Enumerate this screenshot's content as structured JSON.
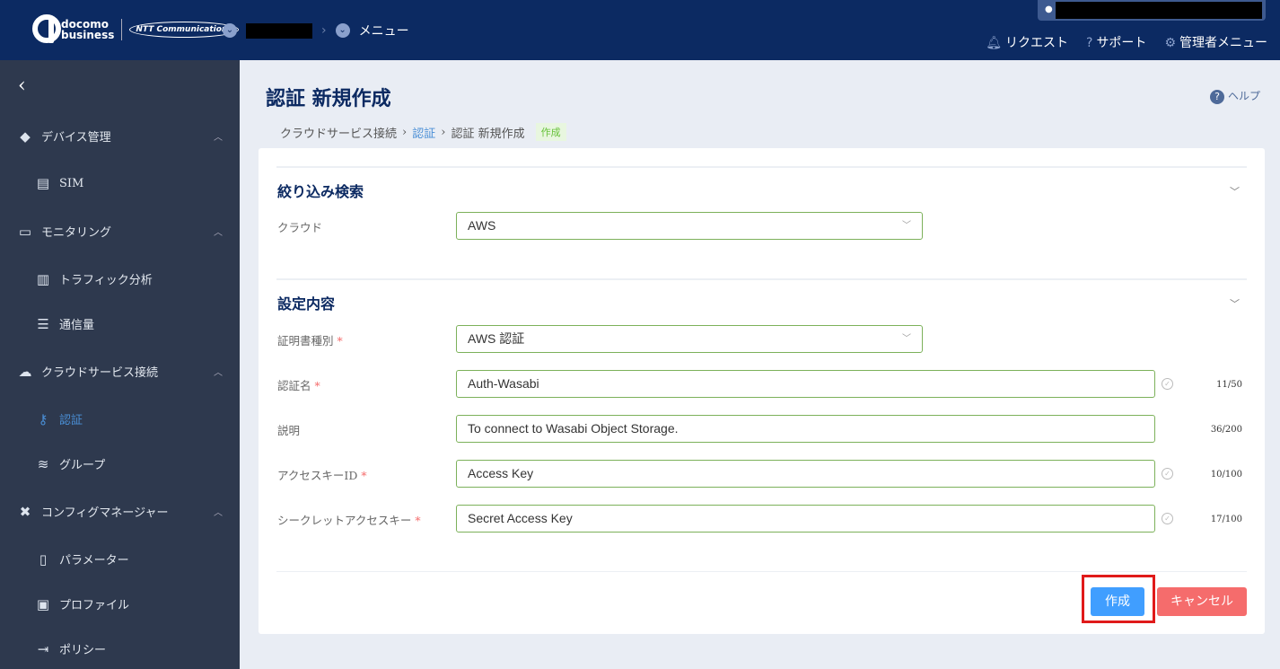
{
  "header": {
    "logo_text": "docomo business",
    "partner_logo": "NTT Communications",
    "menu_label": "メニュー",
    "nav": [
      {
        "label": "リクエスト",
        "icon": "bell-icon"
      },
      {
        "label": "サポート",
        "icon": "question-icon"
      },
      {
        "label": "管理者メニュー",
        "icon": "gear-icon"
      }
    ]
  },
  "sidebar": {
    "items": [
      {
        "label": "デバイス管理",
        "icon": "cubes-icon",
        "type": "group"
      },
      {
        "label": "SIM",
        "icon": "sim-icon",
        "type": "sub"
      },
      {
        "label": "モニタリング",
        "icon": "monitor-icon",
        "type": "group"
      },
      {
        "label": "トラフィック分析",
        "icon": "bar-chart-icon",
        "type": "sub"
      },
      {
        "label": "通信量",
        "icon": "list-chart-icon",
        "type": "sub"
      },
      {
        "label": "クラウドサービス接続",
        "icon": "cloud-icon",
        "type": "group"
      },
      {
        "label": "認証",
        "icon": "key-icon",
        "type": "sub",
        "active": true
      },
      {
        "label": "グループ",
        "icon": "layers-icon",
        "type": "sub"
      },
      {
        "label": "コンフィグマネージャー",
        "icon": "tools-icon",
        "type": "group"
      },
      {
        "label": "パラメーター",
        "icon": "code-file-icon",
        "type": "sub"
      },
      {
        "label": "プロファイル",
        "icon": "box-upload-icon",
        "type": "sub"
      },
      {
        "label": "ポリシー",
        "icon": "file-export-icon",
        "type": "sub"
      }
    ]
  },
  "page": {
    "title": "認証 新規作成",
    "help": "ヘルプ",
    "breadcrumb": [
      "クラウドサービス接続",
      "認証",
      "認証 新規作成"
    ],
    "badge": "作成"
  },
  "filter": {
    "title": "絞り込み検索",
    "cloud_label": "クラウド",
    "cloud_value": "AWS"
  },
  "settings": {
    "title": "設定内容",
    "cert_type_label": "証明書種別",
    "cert_type_value": "AWS 認証",
    "fields": [
      {
        "label": "認証名",
        "value": "Auth-Wasabi",
        "count": "11/50",
        "required": true
      },
      {
        "label": "説明",
        "value": "To connect to Wasabi Object Storage.",
        "count": "36/200",
        "required": false
      },
      {
        "label": "アクセスキーID",
        "value": "Access Key",
        "count": "10/100",
        "required": true
      },
      {
        "label": "シークレットアクセスキー",
        "value": "Secret Access Key",
        "count": "17/100",
        "required": true
      }
    ]
  },
  "actions": {
    "create": "作成",
    "cancel": "キャンセル"
  },
  "colors": {
    "header": "#0c2a62",
    "sidebar": "#2e394e",
    "primary": "#409eff",
    "danger": "#f56c6c",
    "highlight": "#e01a1a"
  }
}
